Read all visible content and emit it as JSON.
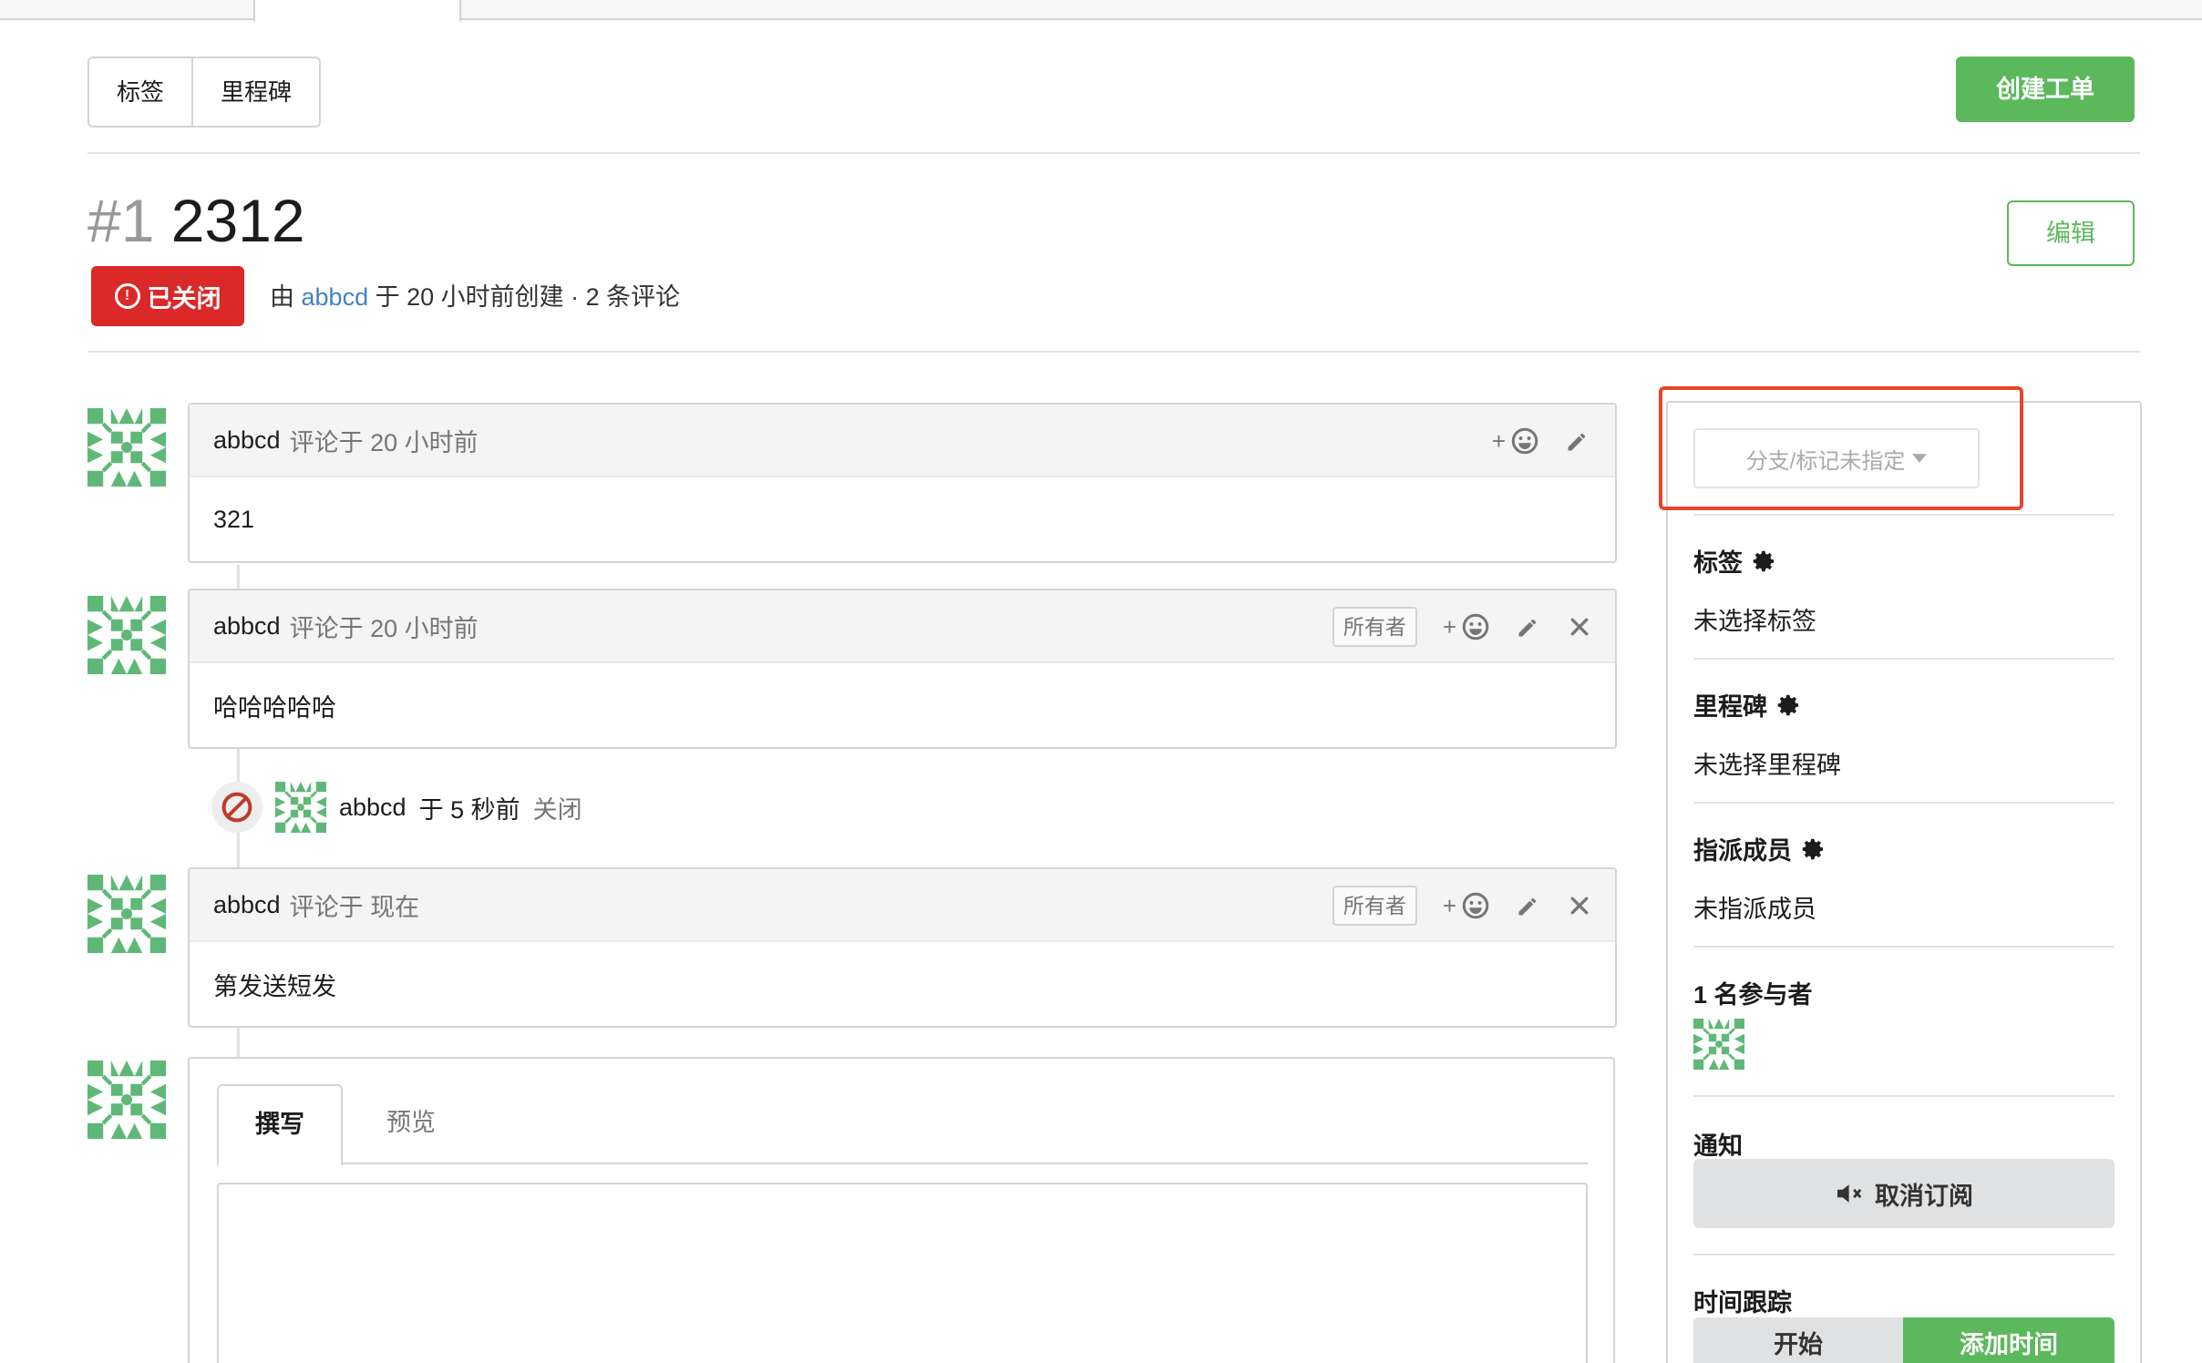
{
  "filters": {
    "labels": "标签",
    "milestones": "里程碑"
  },
  "create_button": "创建工单",
  "issue": {
    "number": "#1",
    "title": "2312",
    "status": "已关闭",
    "meta_prefix": "由",
    "author": "abbcd",
    "meta_suffix": "于 20 小时前创建 · 2 条评论",
    "edit": "编辑"
  },
  "comments": [
    {
      "author": "abbcd",
      "time": "评论于 20 小时前",
      "owner": "",
      "body": "321"
    },
    {
      "author": "abbcd",
      "time": "评论于 20 小时前",
      "owner": "所有者",
      "body": "哈哈哈哈哈"
    },
    {
      "author": "abbcd",
      "time": "评论于 现在",
      "owner": "所有者",
      "body": "第发送短发"
    }
  ],
  "event": {
    "author": "abbcd",
    "text_mid": "于 5 秒前",
    "action": "关闭"
  },
  "reaction_plus": "+",
  "editor": {
    "tab_write": "撰写",
    "tab_preview": "预览"
  },
  "sidebar": {
    "branch": "分支/标记未指定",
    "labels_title": "标签",
    "labels_value": "未选择标签",
    "milestone_title": "里程碑",
    "milestone_value": "未选择里程碑",
    "assignees_title": "指派成员",
    "assignees_value": "未指派成员",
    "participants_title": "1 名参与者",
    "notify_title": "通知",
    "unsubscribe": "取消订阅",
    "time_title": "时间跟踪",
    "time_start": "开始",
    "time_add": "添加时间"
  },
  "colors": {
    "green": "#5cb85c",
    "red": "#db2828",
    "link": "#4183c4",
    "avatar": "#5fb877",
    "highlight": "#e8452c"
  }
}
